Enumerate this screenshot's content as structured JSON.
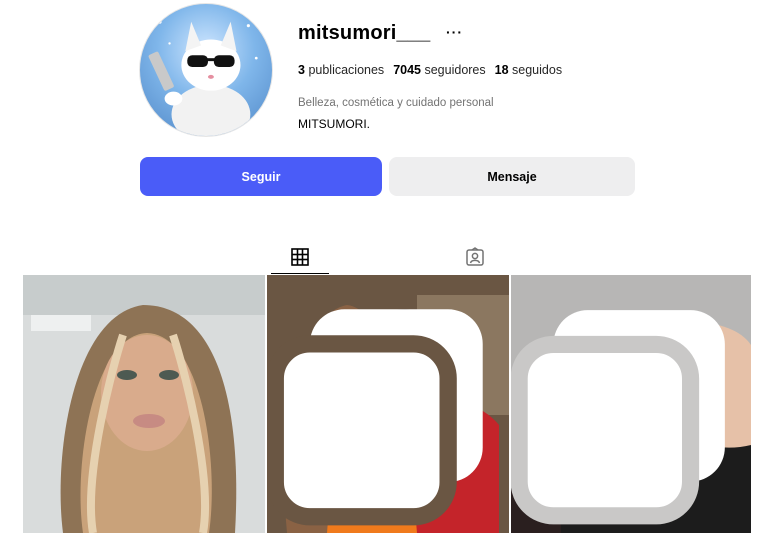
{
  "profile": {
    "username": "mitsumori___",
    "more_label": "···",
    "stats": {
      "posts_value": "3",
      "posts_label": "publicaciones",
      "followers_value": "7045",
      "followers_label": "seguidores",
      "following_value": "18",
      "following_label": "seguidos"
    },
    "category": "Belleza, cosmética y cuidado personal",
    "bio": "MITSUMORI."
  },
  "actions": {
    "follow_label": "Seguir",
    "message_label": "Mensaje"
  },
  "tabs": {
    "active": "posts",
    "icons": [
      "grid-icon",
      "tagged-icon"
    ]
  },
  "colors": {
    "follow_button": "#4a5cf8",
    "message_button": "#eeeeef",
    "text": "#262626"
  }
}
